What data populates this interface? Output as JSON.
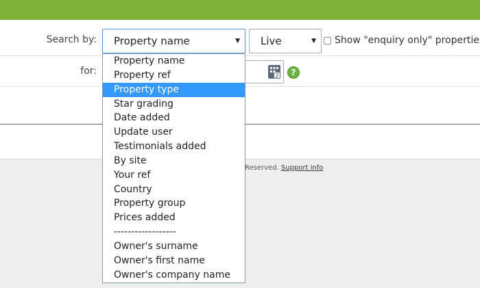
{
  "search": {
    "label": "Search by:",
    "field_selected": "Property name",
    "status_selected": "Live",
    "checkbox_label": "Show \"enquiry only\" properties",
    "checkbox_checked": false
  },
  "for": {
    "label": "for:",
    "value": ""
  },
  "icons": {
    "calculator": "calculator-icon",
    "help": "help-icon",
    "help_glyph": "?"
  },
  "dropdown": {
    "highlighted": "Property type",
    "options": [
      "Property name",
      "Property ref",
      "Property type",
      "Star grading",
      "Date added",
      "Update user",
      "Testimonials added",
      "By site",
      "Your ref",
      "Country",
      "Property group",
      "Prices added",
      "------------------",
      "Owner's surname",
      "Owner's first name",
      "Owner's company name"
    ]
  },
  "footer": {
    "reserved": "Reserved.",
    "support_link": "Support info"
  },
  "colors": {
    "topbar": "#7db037",
    "highlight": "#3399ff",
    "help": "#6db33f"
  }
}
